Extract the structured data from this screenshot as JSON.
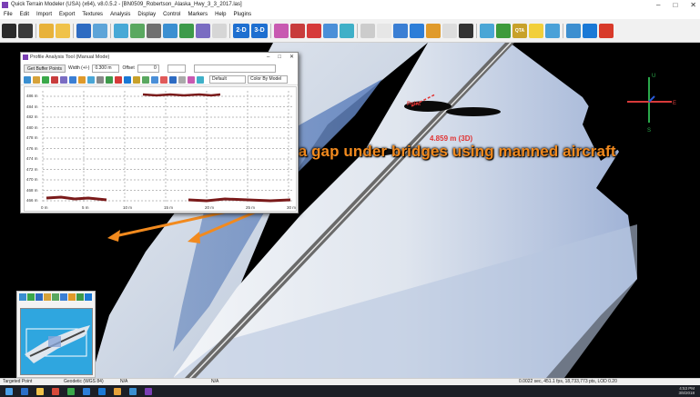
{
  "window": {
    "title": "Quick Terrain Modeler (USA) (x64), v8.0.5.2 - [BN0509_Robertson_Alaska_Hwy_3_3_2017.las]",
    "controls": [
      "–",
      "□",
      "✕"
    ]
  },
  "menu": [
    "File",
    "Edit",
    "Import",
    "Export",
    "Textures",
    "Analysis",
    "Display",
    "Control",
    "Markers",
    "Help",
    "Plugins"
  ],
  "toolbar": {
    "icons": [
      {
        "name": "binoculars-icon",
        "color": "#2b2b2b"
      },
      {
        "name": "camera-icon",
        "color": "#3a3a3a"
      },
      {
        "name": "open-folder-icon",
        "color": "#e8b23a"
      },
      {
        "name": "folder-icon",
        "color": "#f0c24a"
      },
      {
        "name": "save-icon",
        "color": "#2d6bc2"
      },
      {
        "name": "surface-icon",
        "color": "#5da4d8"
      },
      {
        "name": "contour-icon",
        "color": "#48a9d6"
      },
      {
        "name": "profile-icon",
        "color": "#5aa860"
      },
      {
        "name": "grid-icon",
        "color": "#6f6f6f"
      },
      {
        "name": "globe-icon",
        "color": "#3b8fd1"
      },
      {
        "name": "layers-icon",
        "color": "#3d9a4a"
      },
      {
        "name": "palette-icon",
        "color": "#7a6cc2"
      },
      {
        "name": "light-icon",
        "color": "#d6d6d6"
      },
      {
        "name": "view-2d-icon",
        "color": "#1e6fd0"
      },
      {
        "name": "view-3d-icon",
        "color": "#1e6fd0"
      },
      {
        "name": "flythrough-icon",
        "color": "#c85ab1"
      },
      {
        "name": "brush-icon",
        "color": "#c83c3c"
      },
      {
        "name": "marker-icon",
        "color": "#d63a3a"
      },
      {
        "name": "surface-model-icon",
        "color": "#4a8fd8"
      },
      {
        "name": "terrain-icon",
        "color": "#3fb0c8"
      },
      {
        "name": "cross-section-icon",
        "color": "#cccccc"
      },
      {
        "name": "sphere-icon",
        "color": "#e6e6e6"
      },
      {
        "name": "line-tool-icon",
        "color": "#3b7fd4"
      },
      {
        "name": "rectangle-tool-icon",
        "color": "#2d7ed8"
      },
      {
        "name": "slope-icon",
        "color": "#e09a2a"
      },
      {
        "name": "eye-icon",
        "color": "#dddddd"
      },
      {
        "name": "target-icon",
        "color": "#333333"
      },
      {
        "name": "watershed-icon",
        "color": "#4aa6d6"
      },
      {
        "name": "tree-icon",
        "color": "#3d9a3a"
      },
      {
        "name": "qta-tool-icon",
        "color": "#c8a12a"
      },
      {
        "name": "bulb-icon",
        "color": "#f2cf3a"
      },
      {
        "name": "chart-icon",
        "color": "#4aa1d8"
      },
      {
        "name": "checklist-icon",
        "color": "#3d8fd0"
      },
      {
        "name": "info-icon",
        "color": "#1a79d6"
      },
      {
        "name": "stop-icon",
        "color": "#d83a2a"
      }
    ],
    "view_2d_label": "2-D",
    "view_3d_label": "3-D",
    "qta_label": "QTA"
  },
  "profile_tool": {
    "title": "Profile Analysis Tool (Manual Mode)",
    "get_buffer_points": "Get Buffer Points",
    "width_label": "Width (+/-)",
    "width_value": "0.300 m",
    "offset_label": "Offset",
    "offset_value": "0",
    "mode_select": "Default",
    "color_select": "Color By Model",
    "y_ticks": [
      "486 m",
      "484 m",
      "482 m",
      "480 m",
      "478 m",
      "476 m",
      "474 m",
      "472 m",
      "470 m",
      "468 m",
      "466 m"
    ],
    "x_ticks": [
      "0 m",
      "5 m",
      "10 m",
      "15 m",
      "20 m",
      "25 m",
      "30 m"
    ]
  },
  "annotation": {
    "text": "Data gap under bridges using manned aircraft",
    "color": "#f28a1e"
  },
  "measurement": {
    "label": "4.859 m (3D)",
    "point_label": "Point"
  },
  "axis_gizmo": {
    "up": "U",
    "east": "E",
    "south": "S",
    "west": "W"
  },
  "statusbar": {
    "targeted_point": "Targeted Point",
    "geodetic": "Geodetic (WGS 84)",
    "na1": "N/A",
    "na2": "N/A",
    "render_stats": "0.0022 sec, 451.1 fps,  18,733,773 pts, LOD 0.20"
  },
  "taskbar": {
    "time": "4:53 PM",
    "date": "3/8/2018"
  }
}
